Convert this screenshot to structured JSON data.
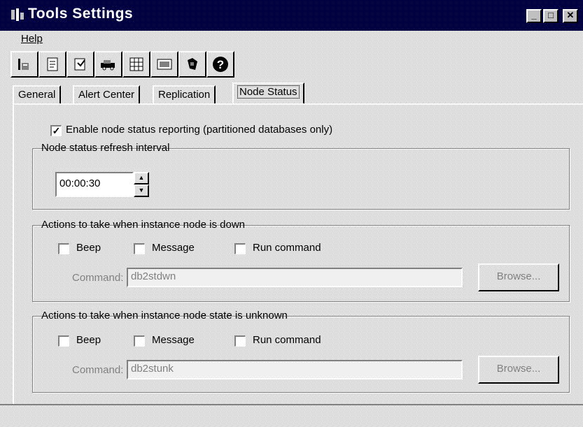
{
  "window": {
    "title": "Tools Settings",
    "minimize_label": "_",
    "maximize_label": "□",
    "close_label": "✕"
  },
  "menu": {
    "help": "Help"
  },
  "toolbar": {
    "icons": [
      "instance-icon",
      "properties-icon",
      "script-icon",
      "vehicle-icon",
      "grid-icon",
      "message-icon",
      "db2-icon",
      "help-icon"
    ]
  },
  "tabs": [
    "General",
    "Alert Center",
    "Replication",
    "Node Status"
  ],
  "node_status": {
    "enable_label": "Enable node status reporting (partitioned databases only)",
    "enable_checked": true,
    "refresh_group_title": "Node status refresh interval",
    "refresh_value": "00:00:30",
    "down_group": {
      "title": "Actions to take when instance node is down",
      "beep": "Beep",
      "message": "Message",
      "run_command": "Run command",
      "command_label": "Command:",
      "command_value": "db2stdwn",
      "browse": "Browse..."
    },
    "unknown_group": {
      "title": "Actions to take when instance node state is unknown",
      "beep": "Beep",
      "message": "Message",
      "run_command": "Run command",
      "command_label": "Command:",
      "command_value": "db2stunk",
      "browse": "Browse..."
    }
  },
  "colors": {
    "titlebar": "#000080",
    "face": "#c0c0c0"
  }
}
